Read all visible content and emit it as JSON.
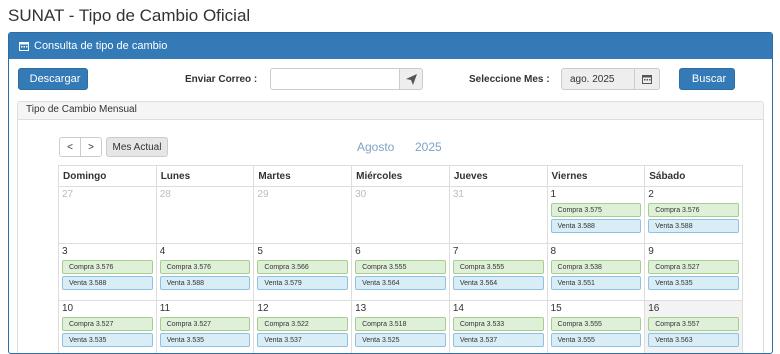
{
  "page_title": "SUNAT - Tipo de Cambio Oficial",
  "panel_title": "Consulta de tipo de cambio",
  "toolbar": {
    "download_label": "Descargar",
    "email_label": "Enviar Correo :",
    "email_value": "",
    "month_label": "Seleccione Mes :",
    "month_value": "ago. 2025",
    "search_label": "Buscar"
  },
  "monthly_title": "Tipo de Cambio Mensual",
  "nav": {
    "prev": "<",
    "next": ">",
    "current": "Mes Actual"
  },
  "month_name": "Agosto",
  "year": "2025",
  "weekdays": [
    "Domingo",
    "Lunes",
    "Martes",
    "Miércoles",
    "Jueves",
    "Viernes",
    "Sábado"
  ],
  "weeks": [
    [
      {
        "day": "27",
        "muted": true
      },
      {
        "day": "28",
        "muted": true
      },
      {
        "day": "29",
        "muted": true
      },
      {
        "day": "30",
        "muted": true
      },
      {
        "day": "31",
        "muted": true
      },
      {
        "day": "1",
        "compra": "Compra 3.575",
        "venta": "Venta 3.588"
      },
      {
        "day": "2",
        "compra": "Compra 3.576",
        "venta": "Venta 3.588"
      }
    ],
    [
      {
        "day": "3",
        "compra": "Compra 3.576",
        "venta": "Venta 3.588"
      },
      {
        "day": "4",
        "compra": "Compra 3.576",
        "venta": "Venta 3.588"
      },
      {
        "day": "5",
        "compra": "Compra 3.566",
        "venta": "Venta 3.579"
      },
      {
        "day": "6",
        "compra": "Compra 3.555",
        "venta": "Venta 3.564"
      },
      {
        "day": "7",
        "compra": "Compra 3.555",
        "venta": "Venta 3.564"
      },
      {
        "day": "8",
        "compra": "Compra 3.538",
        "venta": "Venta 3.551"
      },
      {
        "day": "9",
        "compra": "Compra 3.527",
        "venta": "Venta 3.535"
      }
    ],
    [
      {
        "day": "10",
        "compra": "Compra 3.527",
        "venta": "Venta 3.535"
      },
      {
        "day": "11",
        "compra": "Compra 3.527",
        "venta": "Venta 3.535"
      },
      {
        "day": "12",
        "compra": "Compra 3.522",
        "venta": "Venta 3.537"
      },
      {
        "day": "13",
        "compra": "Compra 3.518",
        "venta": "Venta 3.525"
      },
      {
        "day": "14",
        "compra": "Compra 3.533",
        "venta": "Venta 3.537"
      },
      {
        "day": "15",
        "compra": "Compra 3.555",
        "venta": "Venta 3.555"
      },
      {
        "day": "16",
        "compra": "Compra 3.557",
        "venta": "Venta 3.563",
        "today": true
      }
    ]
  ],
  "colors": {
    "primary": "#337ab7",
    "compra_bg": "#dff0d8",
    "venta_bg": "#d9edf7"
  }
}
